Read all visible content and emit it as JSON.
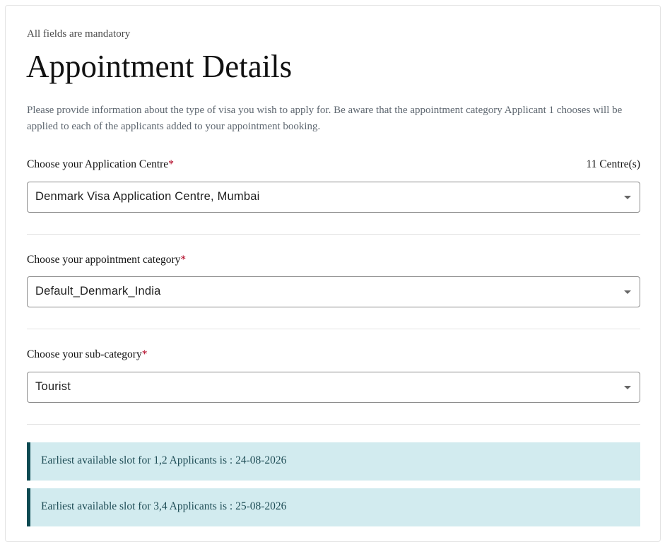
{
  "form": {
    "mandatory_note": "All fields are mandatory",
    "title": "Appointment Details",
    "description": "Please provide information about the type of visa you wish to apply for. Be aware that the appointment category Applicant 1 chooses will be applied to each of the applicants added to your appointment booking.",
    "required_mark": "*",
    "centre": {
      "label": "Choose your Application Centre",
      "count": "11 Centre(s)",
      "value": "Denmark Visa Application Centre, Mumbai"
    },
    "category": {
      "label": "Choose your appointment category",
      "value": "Default_Denmark_India"
    },
    "subcategory": {
      "label": "Choose your sub-category",
      "value": "Tourist"
    }
  },
  "slots": [
    {
      "text": "Earliest available slot for 1,2 Applicants is : 24-08-2026"
    },
    {
      "text": "Earliest available slot for 3,4 Applicants is : 25-08-2026"
    }
  ],
  "colors": {
    "accent": "#0c4a52",
    "slot_bg": "#d2ebef",
    "required": "#b00020"
  }
}
